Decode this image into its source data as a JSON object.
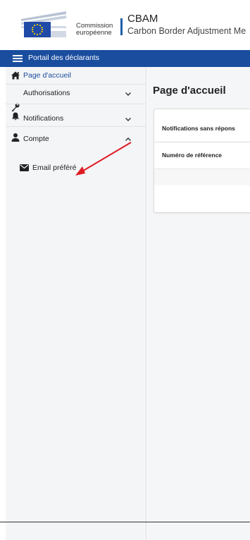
{
  "header": {
    "ec_text_line1": "Commission",
    "ec_text_line2": "européenne",
    "app_title": "CBAM",
    "app_subtitle": "Carbon Border Adjustment Me"
  },
  "topbar": {
    "label": "Portail des déclarants"
  },
  "sidebar": {
    "items": [
      {
        "label": "Page d'accueil",
        "icon": "home-icon",
        "active": true
      },
      {
        "label": "Authorisations",
        "icon": "key-icon",
        "chevron": "down"
      },
      {
        "label": "Notifications",
        "icon": "bell-icon",
        "chevron": "down"
      },
      {
        "label": "Compte",
        "icon": "user-icon",
        "chevron": "up"
      }
    ],
    "sub_items": [
      {
        "label": "Email préféré",
        "icon": "envelope-icon"
      }
    ]
  },
  "main": {
    "title": "Page d'accueil",
    "card": {
      "title": "Notifications sans répons",
      "column_header": "Numéro de référence"
    }
  },
  "colors": {
    "brand_blue": "#1a4d9e",
    "annotation_red": "#e01a22"
  }
}
